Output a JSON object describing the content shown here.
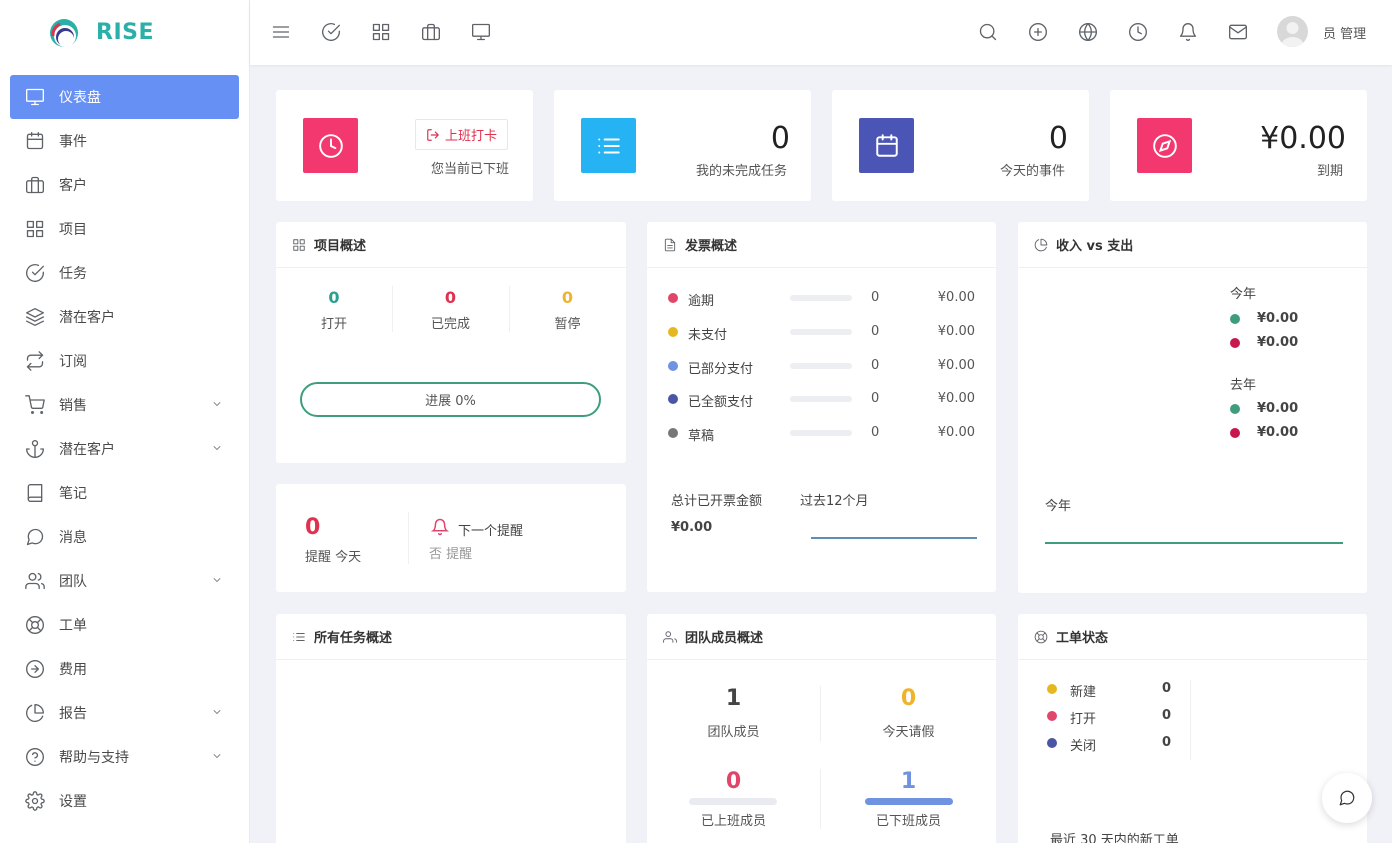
{
  "app": {
    "name": "RISE"
  },
  "sidebar": {
    "items": [
      {
        "label": "仪表盘",
        "icon": "monitor-icon",
        "active": true
      },
      {
        "label": "事件",
        "icon": "calendar-icon"
      },
      {
        "label": "客户",
        "icon": "briefcase-icon"
      },
      {
        "label": "项目",
        "icon": "grid-icon"
      },
      {
        "label": "任务",
        "icon": "check-circle-icon"
      },
      {
        "label": "潜在客户",
        "icon": "layers-icon"
      },
      {
        "label": "订阅",
        "icon": "repeat-icon"
      },
      {
        "label": "销售",
        "icon": "cart-icon",
        "has_children": true
      },
      {
        "label": "潜在客户",
        "icon": "anchor-icon",
        "has_children": true
      },
      {
        "label": "笔记",
        "icon": "book-icon"
      },
      {
        "label": "消息",
        "icon": "message-icon"
      },
      {
        "label": "团队",
        "icon": "users-icon",
        "has_children": true
      },
      {
        "label": "工单",
        "icon": "life-buoy-icon"
      },
      {
        "label": "费用",
        "icon": "arrow-circle-icon"
      },
      {
        "label": "报告",
        "icon": "pie-chart-icon",
        "has_children": true
      },
      {
        "label": "帮助与支持",
        "icon": "help-circle-icon",
        "has_children": true
      },
      {
        "label": "设置",
        "icon": "settings-icon"
      }
    ]
  },
  "topbar": {
    "user_name": "员 管理",
    "left_icons": [
      "menu-icon",
      "check-circle-icon",
      "grid-icon",
      "briefcase-icon",
      "monitor-icon"
    ],
    "right_icons": [
      "search-icon",
      "plus-circle-icon",
      "globe-icon",
      "clock-icon",
      "bell-icon",
      "mail-icon"
    ]
  },
  "widgets": {
    "clock": {
      "button_label": "上班打卡",
      "status": "您当前已下班",
      "color": "#f2386f"
    },
    "open_tasks": {
      "value": "0",
      "label": "我的未完成任务",
      "color": "#25b3f4"
    },
    "events_today": {
      "value": "0",
      "label": "今天的事件",
      "color": "#4b55b6"
    },
    "due": {
      "value": "¥0.00",
      "label": "到期",
      "color": "#f2386f"
    }
  },
  "projects": {
    "title": "项目概述",
    "stats": [
      {
        "value": "0",
        "label": "打开",
        "color": "#2aa18f"
      },
      {
        "value": "0",
        "label": "已完成",
        "color": "#e0314f"
      },
      {
        "value": "0",
        "label": "暂停",
        "color": "#efb32c"
      }
    ],
    "progress_label": "进展 0%",
    "progress": 0
  },
  "reminders": {
    "count": "0",
    "count_label": "提醒 今天",
    "next_label": "下一个提醒",
    "next_value": "否 提醒"
  },
  "invoices": {
    "title": "发票概述",
    "rows": [
      {
        "label": "逾期",
        "count": "0",
        "amount": "¥0.00",
        "color": "#e0466a"
      },
      {
        "label": "未支付",
        "count": "0",
        "amount": "¥0.00",
        "color": "#e6b820"
      },
      {
        "label": "已部分支付",
        "count": "0",
        "amount": "¥0.00",
        "color": "#6f92e1"
      },
      {
        "label": "已全额支付",
        "count": "0",
        "amount": "¥0.00",
        "color": "#4b55a5"
      },
      {
        "label": "草稿",
        "count": "0",
        "amount": "¥0.00",
        "color": "#777777"
      }
    ],
    "total_label": "总计已开票金额",
    "total_value": "¥0.00",
    "period_label": "过去12个月"
  },
  "income_expense": {
    "title": "收入 vs 支出",
    "this_year_label": "今年",
    "this_year_income": "¥0.00",
    "this_year_expense": "¥0.00",
    "last_year_label": "去年",
    "last_year_income": "¥0.00",
    "last_year_expense": "¥0.00",
    "chart_label": "今年",
    "income_color": "#3e9e7c",
    "expense_color": "#c8174c"
  },
  "all_tasks": {
    "title": "所有任务概述"
  },
  "team": {
    "title": "团队成员概述",
    "members": "1",
    "members_label": "团队成员",
    "on_leave": "0",
    "on_leave_label": "今天请假",
    "clocked_in": "0",
    "clocked_in_label": "已上班成员",
    "clocked_out": "1",
    "clocked_out_label": "已下班成员"
  },
  "tickets": {
    "title": "工单状态",
    "rows": [
      {
        "label": "新建",
        "count": "0",
        "color": "#e6b820"
      },
      {
        "label": "打开",
        "count": "0",
        "color": "#e0466a"
      },
      {
        "label": "关闭",
        "count": "0",
        "color": "#4b55a5"
      }
    ],
    "footer": "最近 30 天内的新工单"
  }
}
